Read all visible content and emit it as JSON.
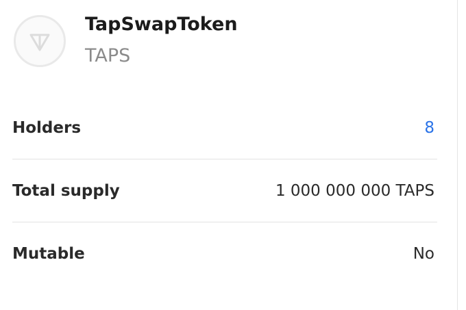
{
  "token": {
    "name": "TapSwapToken",
    "symbol": "TAPS",
    "logo_icon": "ton-diamond-icon"
  },
  "rows": [
    {
      "label": "Holders",
      "value": "8",
      "value_is_link": true
    },
    {
      "label": "Total supply",
      "value": "1 000 000 000 TAPS",
      "value_is_link": false
    },
    {
      "label": "Mutable",
      "value": "No",
      "value_is_link": false
    }
  ],
  "colors": {
    "link": "#2a73e8",
    "muted_text": "#8b8b8b",
    "divider": "#e3e3e3"
  }
}
